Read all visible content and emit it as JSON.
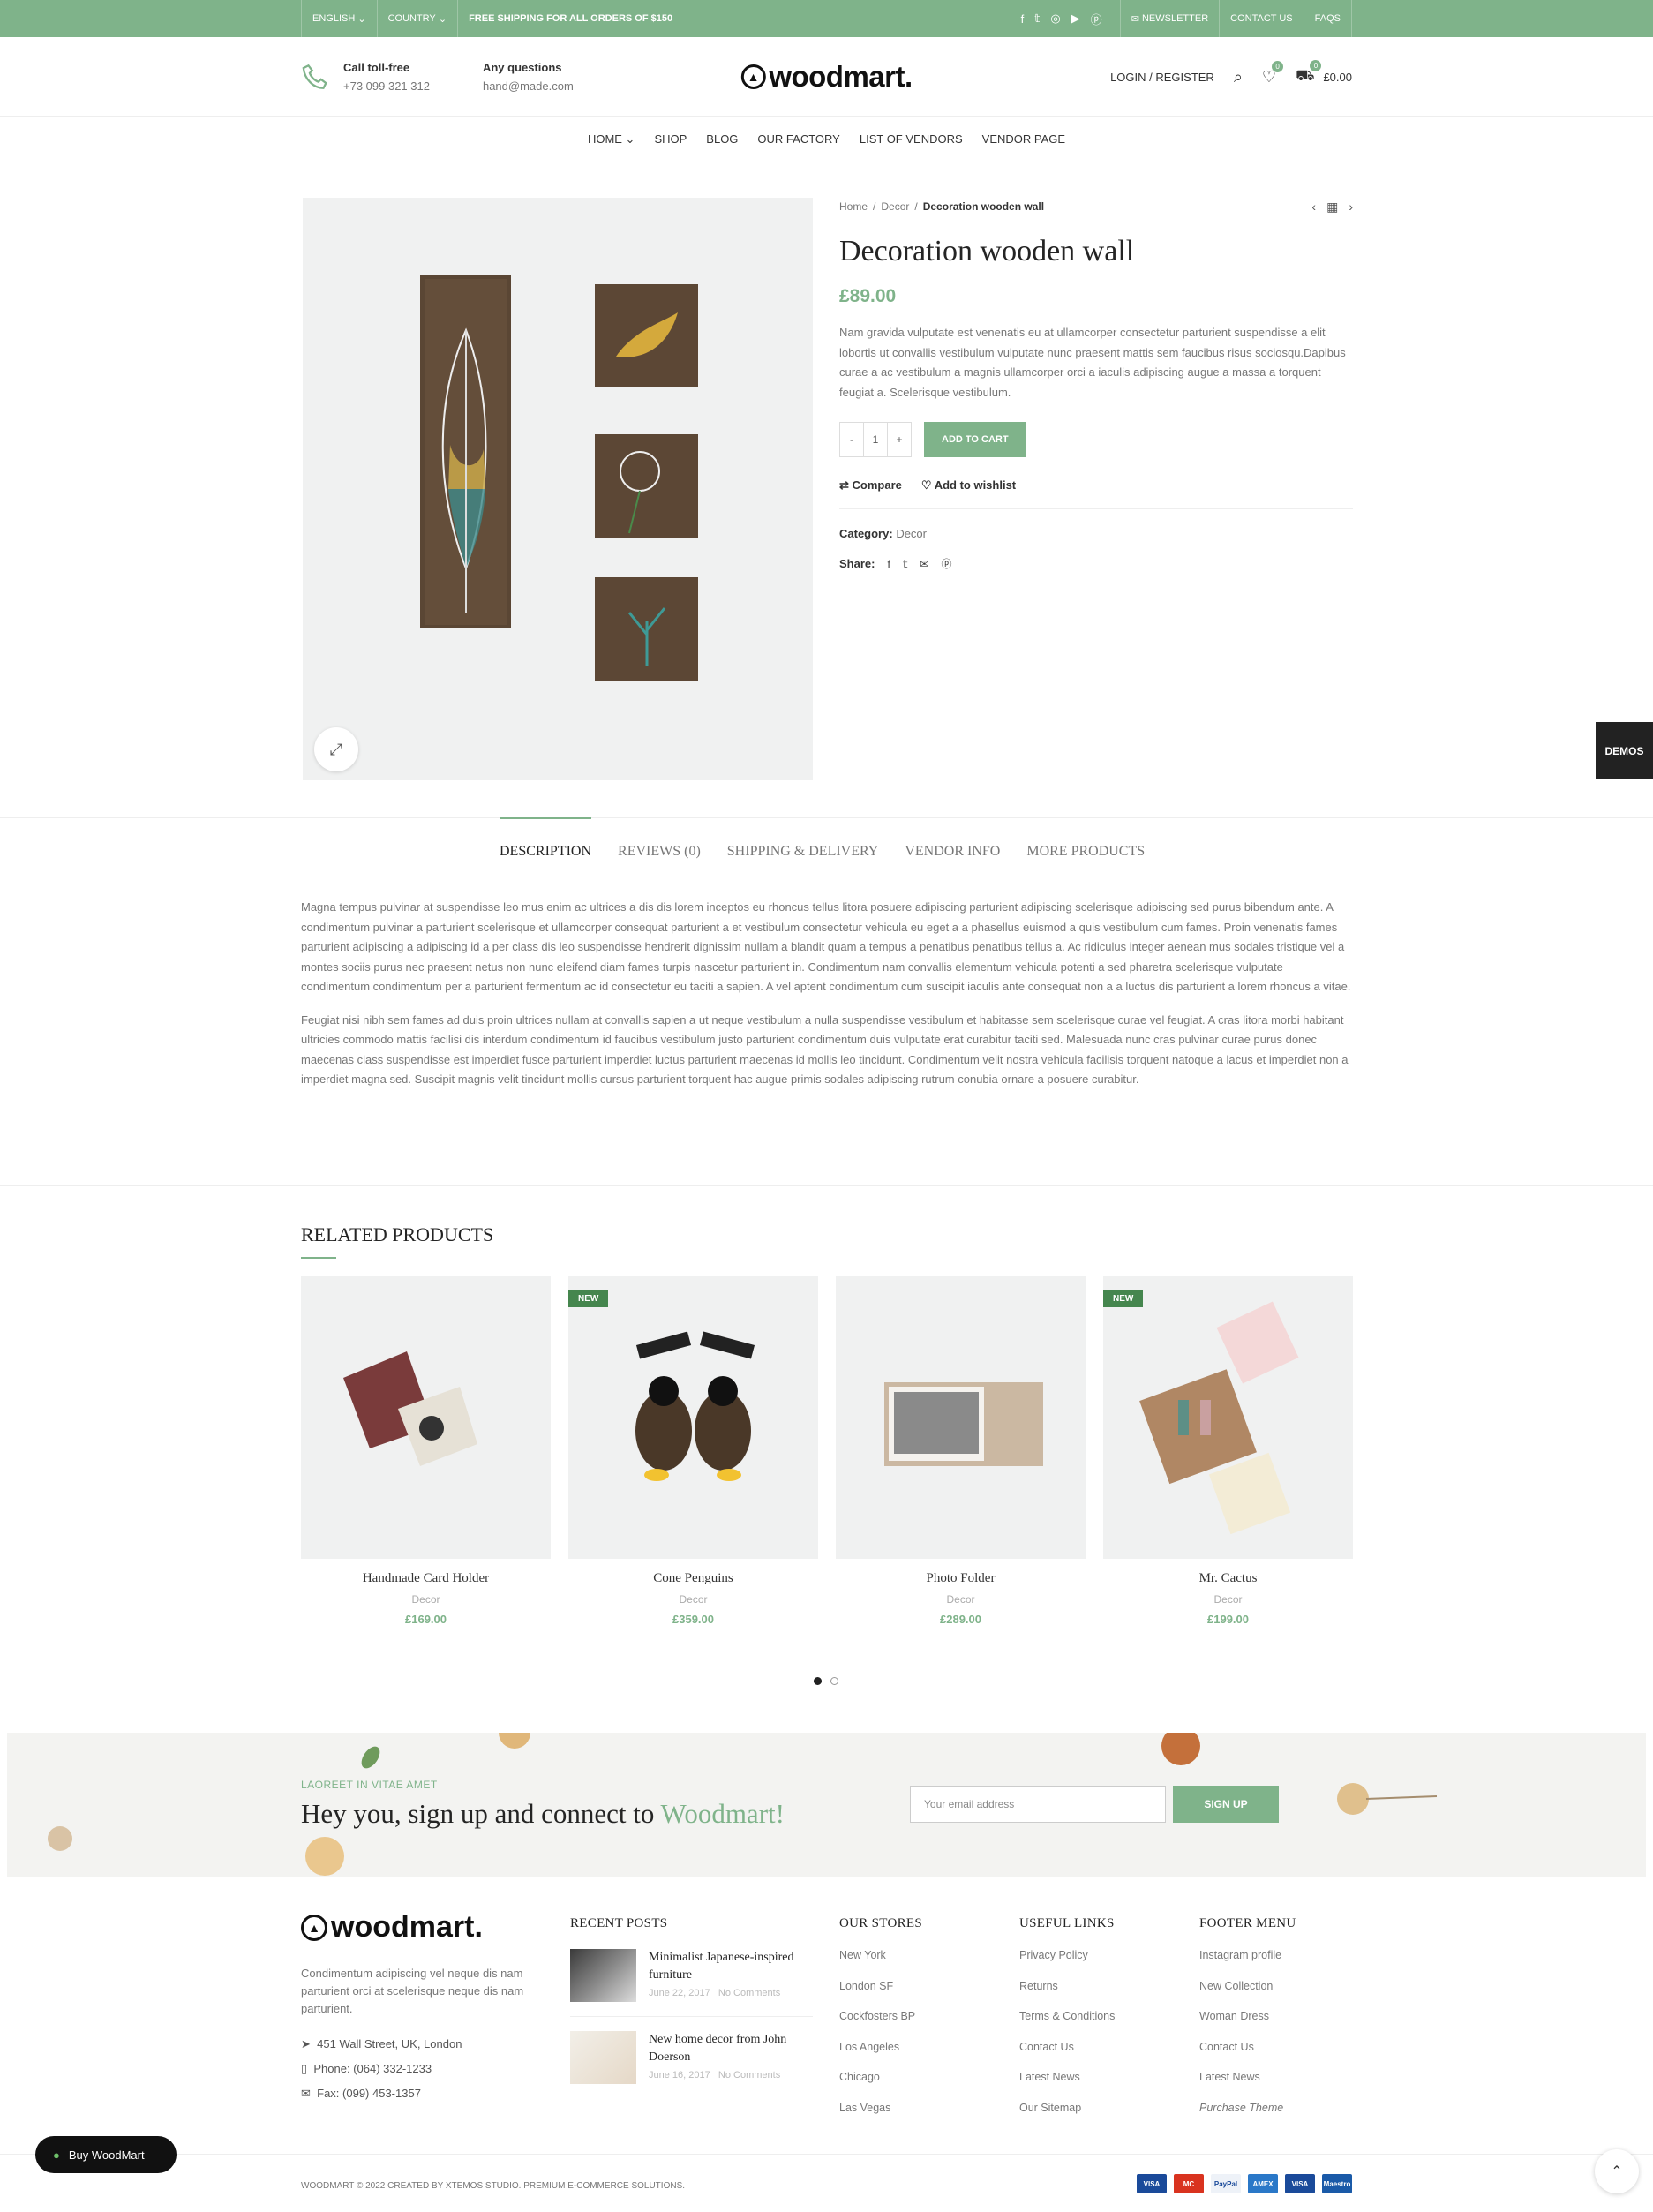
{
  "topbar": {
    "language": "ENGLISH",
    "country": "COUNTRY",
    "shipping": "FREE SHIPPING FOR ALL ORDERS OF $150",
    "newsletter": "NEWSLETTER",
    "contact": "CONTACT US",
    "faqs": "FAQS"
  },
  "header": {
    "call_title": "Call toll-free",
    "call_number": "+73 099 321 312",
    "q_title": "Any questions",
    "q_email": "hand@made.com",
    "logo": "woodmart.",
    "login": "LOGIN / REGISTER",
    "wishlist_count": "0",
    "cart_count": "0",
    "cart_total": "£0.00"
  },
  "nav": [
    "HOME",
    "SHOP",
    "BLOG",
    "OUR FACTORY",
    "LIST OF VENDORS",
    "VENDOR PAGE"
  ],
  "product": {
    "breadcrumb": [
      "Home",
      "Decor",
      "Decoration wooden wall"
    ],
    "title": "Decoration wooden wall",
    "price": "£89.00",
    "description": "Nam gravida vulputate est venenatis eu at ullamcorper consectetur parturient suspendisse a elit lobortis ut convallis vestibulum vulputate nunc praesent mattis sem faucibus risus sociosqu.Dapibus curae a ac vestibulum a magnis ullamcorper orci a iaculis adipiscing augue a massa a torquent feugiat a. Scelerisque vestibulum.",
    "qty": "1",
    "add_to_cart": "ADD TO CART",
    "compare": "Compare",
    "wishlist": "Add to wishlist",
    "category_label": "Category:",
    "category": "Decor",
    "share_label": "Share:"
  },
  "demos": "DEMOS",
  "tabs": {
    "items": [
      "DESCRIPTION",
      "REVIEWS (0)",
      "SHIPPING & DELIVERY",
      "VENDOR INFO",
      "MORE PRODUCTS"
    ],
    "p1": "Magna tempus pulvinar at suspendisse leo mus enim ac ultrices a dis dis lorem inceptos eu rhoncus tellus litora posuere adipiscing parturient adipiscing scelerisque adipiscing sed purus bibendum ante. A condimentum pulvinar a parturient scelerisque et ullamcorper consequat parturient a et vestibulum consectetur vehicula eu eget a a phasellus euismod a quis vestibulum cum fames. Proin venenatis fames parturient adipiscing a adipiscing id a per class dis leo suspendisse hendrerit dignissim nullam a blandit quam a tempus a penatibus penatibus tellus a. Ac ridiculus integer aenean mus sodales tristique vel a montes sociis purus nec praesent netus non nunc eleifend diam fames turpis nascetur parturient in. Condimentum nam convallis elementum vehicula potenti a sed pharetra scelerisque vulputate condimentum condimentum per a parturient fermentum ac id consectetur eu taciti a sapien. A vel aptent condimentum cum suscipit iaculis ante consequat non a a luctus dis parturient a lorem rhoncus a vitae.",
    "p2": "Feugiat nisi nibh sem fames ad duis proin ultrices nullam at convallis sapien a ut neque vestibulum a nulla suspendisse vestibulum et habitasse sem scelerisque curae vel feugiat. A cras litora morbi habitant ultricies commodo mattis facilisi dis interdum condimentum id faucibus vestibulum justo parturient condimentum duis vulputate erat curabitur taciti sed. Malesuada nunc cras pulvinar curae purus donec maecenas class suspendisse est imperdiet fusce parturient imperdiet luctus parturient maecenas id mollis leo tincidunt. Condimentum velit nostra vehicula facilisis torquent natoque a lacus et imperdiet non a imperdiet magna sed. Suscipit magnis velit tincidunt mollis cursus parturient torquent hac augue primis sodales adipiscing rutrum conubia ornare a posuere curabitur."
  },
  "related": {
    "title": "RELATED PRODUCTS",
    "new_label": "NEW",
    "items": [
      {
        "name": "Handmade Card Holder",
        "cat": "Decor",
        "price": "£169.00"
      },
      {
        "name": "Cone Penguins",
        "cat": "Decor",
        "price": "£359.00"
      },
      {
        "name": "Photo Folder",
        "cat": "Decor",
        "price": "£289.00"
      },
      {
        "name": "Mr. Cactus",
        "cat": "Decor",
        "price": "£199.00"
      }
    ]
  },
  "signup": {
    "sub": "LAOREET IN VITAE AMET",
    "heading": "Hey you, sign up and connect to",
    "brand": "Woodmart!",
    "placeholder": "Your email address",
    "button": "SIGN UP"
  },
  "footer": {
    "logo": "woodmart.",
    "desc": "Condimentum adipiscing vel neque dis nam parturient orci at scelerisque neque dis nam parturient.",
    "address": "451 Wall Street, UK, London",
    "phone": "Phone: (064) 332-1233",
    "fax": "Fax: (099) 453-1357",
    "recent_title": "RECENT POSTS",
    "posts": [
      {
        "title": "Minimalist Japanese-inspired furniture",
        "date": "June 22, 2017",
        "comments": "No Comments"
      },
      {
        "title": "New home decor from John Doerson",
        "date": "June 16, 2017",
        "comments": "No Comments"
      }
    ],
    "stores_title": "OUR STORES",
    "stores": [
      "New York",
      "London SF",
      "Cockfosters BP",
      "Los Angeles",
      "Chicago",
      "Las Vegas"
    ],
    "links_title": "USEFUL LINKS",
    "links": [
      "Privacy Policy",
      "Returns",
      "Terms & Conditions",
      "Contact Us",
      "Latest News",
      "Our Sitemap"
    ],
    "menu_title": "FOOTER MENU",
    "menu": [
      "Instagram profile",
      "New Collection",
      "Woman Dress",
      "Contact Us",
      "Latest News",
      "Purchase Theme"
    ]
  },
  "bottom": {
    "copyright": "WOODMART © 2022 CREATED BY XTEMOS STUDIO. PREMIUM E-COMMERCE SOLUTIONS.",
    "payments": [
      "VISA",
      "MC",
      "PayPal",
      "AMEX",
      "VISA",
      "Maestro"
    ]
  },
  "buy_button": "Buy WoodMart",
  "colors": {
    "accent": "#7fb38a",
    "badge_new": "#45864e"
  }
}
